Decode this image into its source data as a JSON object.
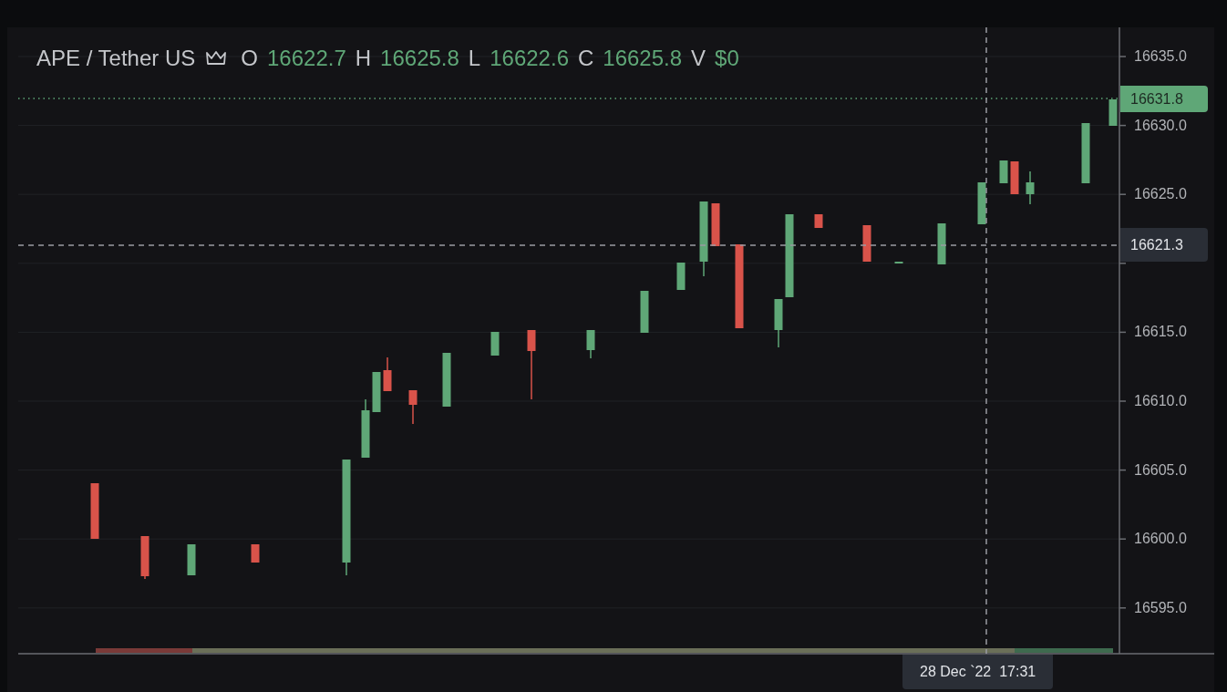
{
  "header": {
    "symbol": "APE / Tether US",
    "ohlcv": [
      {
        "label": "O",
        "value": "16622.7"
      },
      {
        "label": "H",
        "value": "16625.8"
      },
      {
        "label": "L",
        "value": "16622.6"
      },
      {
        "label": "C",
        "value": "16625.8"
      },
      {
        "label": "V",
        "value": "$0"
      }
    ]
  },
  "price_axis": {
    "ticks": [
      "16635.0",
      "16630.0",
      "16625.0",
      "16615.0",
      "16610.0",
      "16605.0",
      "16600.0",
      "16595.0"
    ]
  },
  "last_price": "16631.8",
  "crosshair": {
    "price": "16621.3",
    "time": "28 Dec `22  17:31"
  }
}
